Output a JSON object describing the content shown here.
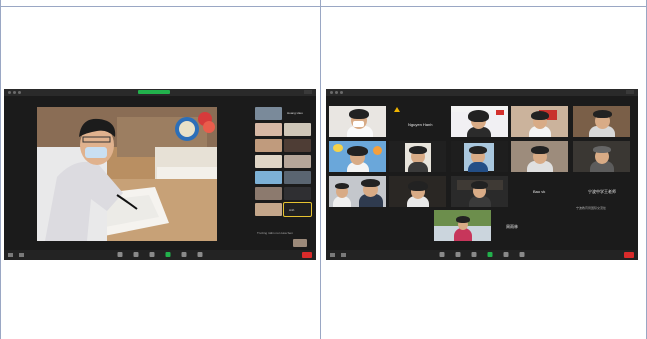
{
  "page": {
    "panel_left": "meeting-window-1",
    "panel_right": "meeting-window-2"
  },
  "window1": {
    "side_labels": [
      "Hoang Hieu",
      "Anh",
      "",
      ""
    ],
    "footer_text": "Trường mầm non Hoa Sen"
  },
  "window2": {
    "names": {
      "tile_warning": "Nguyen Hanh",
      "tile_bao": "Bao vk",
      "tile_chinese": "宁波中学王老师",
      "tile_chinese_sub": "宁波教育局国际交流处",
      "tile_last": "周雨林"
    }
  },
  "colors": {
    "end_button": "#d92b2b",
    "recording": "#22b14c",
    "selected_outline": "#e6c230",
    "border_lines": "#9aa7c4"
  }
}
